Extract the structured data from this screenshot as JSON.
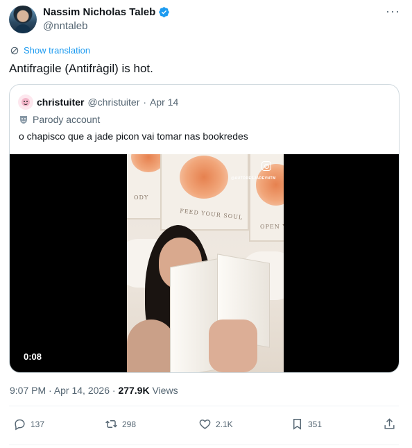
{
  "author": {
    "display_name": "Nassim Nicholas Taleb",
    "handle": "@nntaleb",
    "verified_icon": "verified-badge-icon",
    "more_label": "···"
  },
  "translate": {
    "icon": "translate-icon",
    "label": "Show translation"
  },
  "tweet_text": "Antifragile (Antifràgil) is hot.",
  "quote": {
    "display_name": "christuiter",
    "handle": "@christuiter",
    "dot": "·",
    "date": "Apr 14",
    "badge_label": "Parody account",
    "text": "o chapisco que a jade picon vai tomar nas bookredes",
    "video": {
      "duration": "0:08",
      "poster_text_left": "ODY",
      "poster_text_center": "FEED YOUR SOUL",
      "poster_text_right": "OPEN YO"
    }
  },
  "meta": {
    "time": "9:07 PM",
    "sep1": " · ",
    "date": "Apr 14, 2026",
    "sep2": " · ",
    "views_count": "277.9K",
    "views_label": " Views"
  },
  "actions": {
    "reply_count": "137",
    "retweet_count": "298",
    "like_count": "2.1K",
    "bookmark_count": "351"
  },
  "colors": {
    "accent": "#1d9bf0",
    "text": "#0f1419",
    "secondary": "#536471",
    "border": "#cfd9de"
  }
}
